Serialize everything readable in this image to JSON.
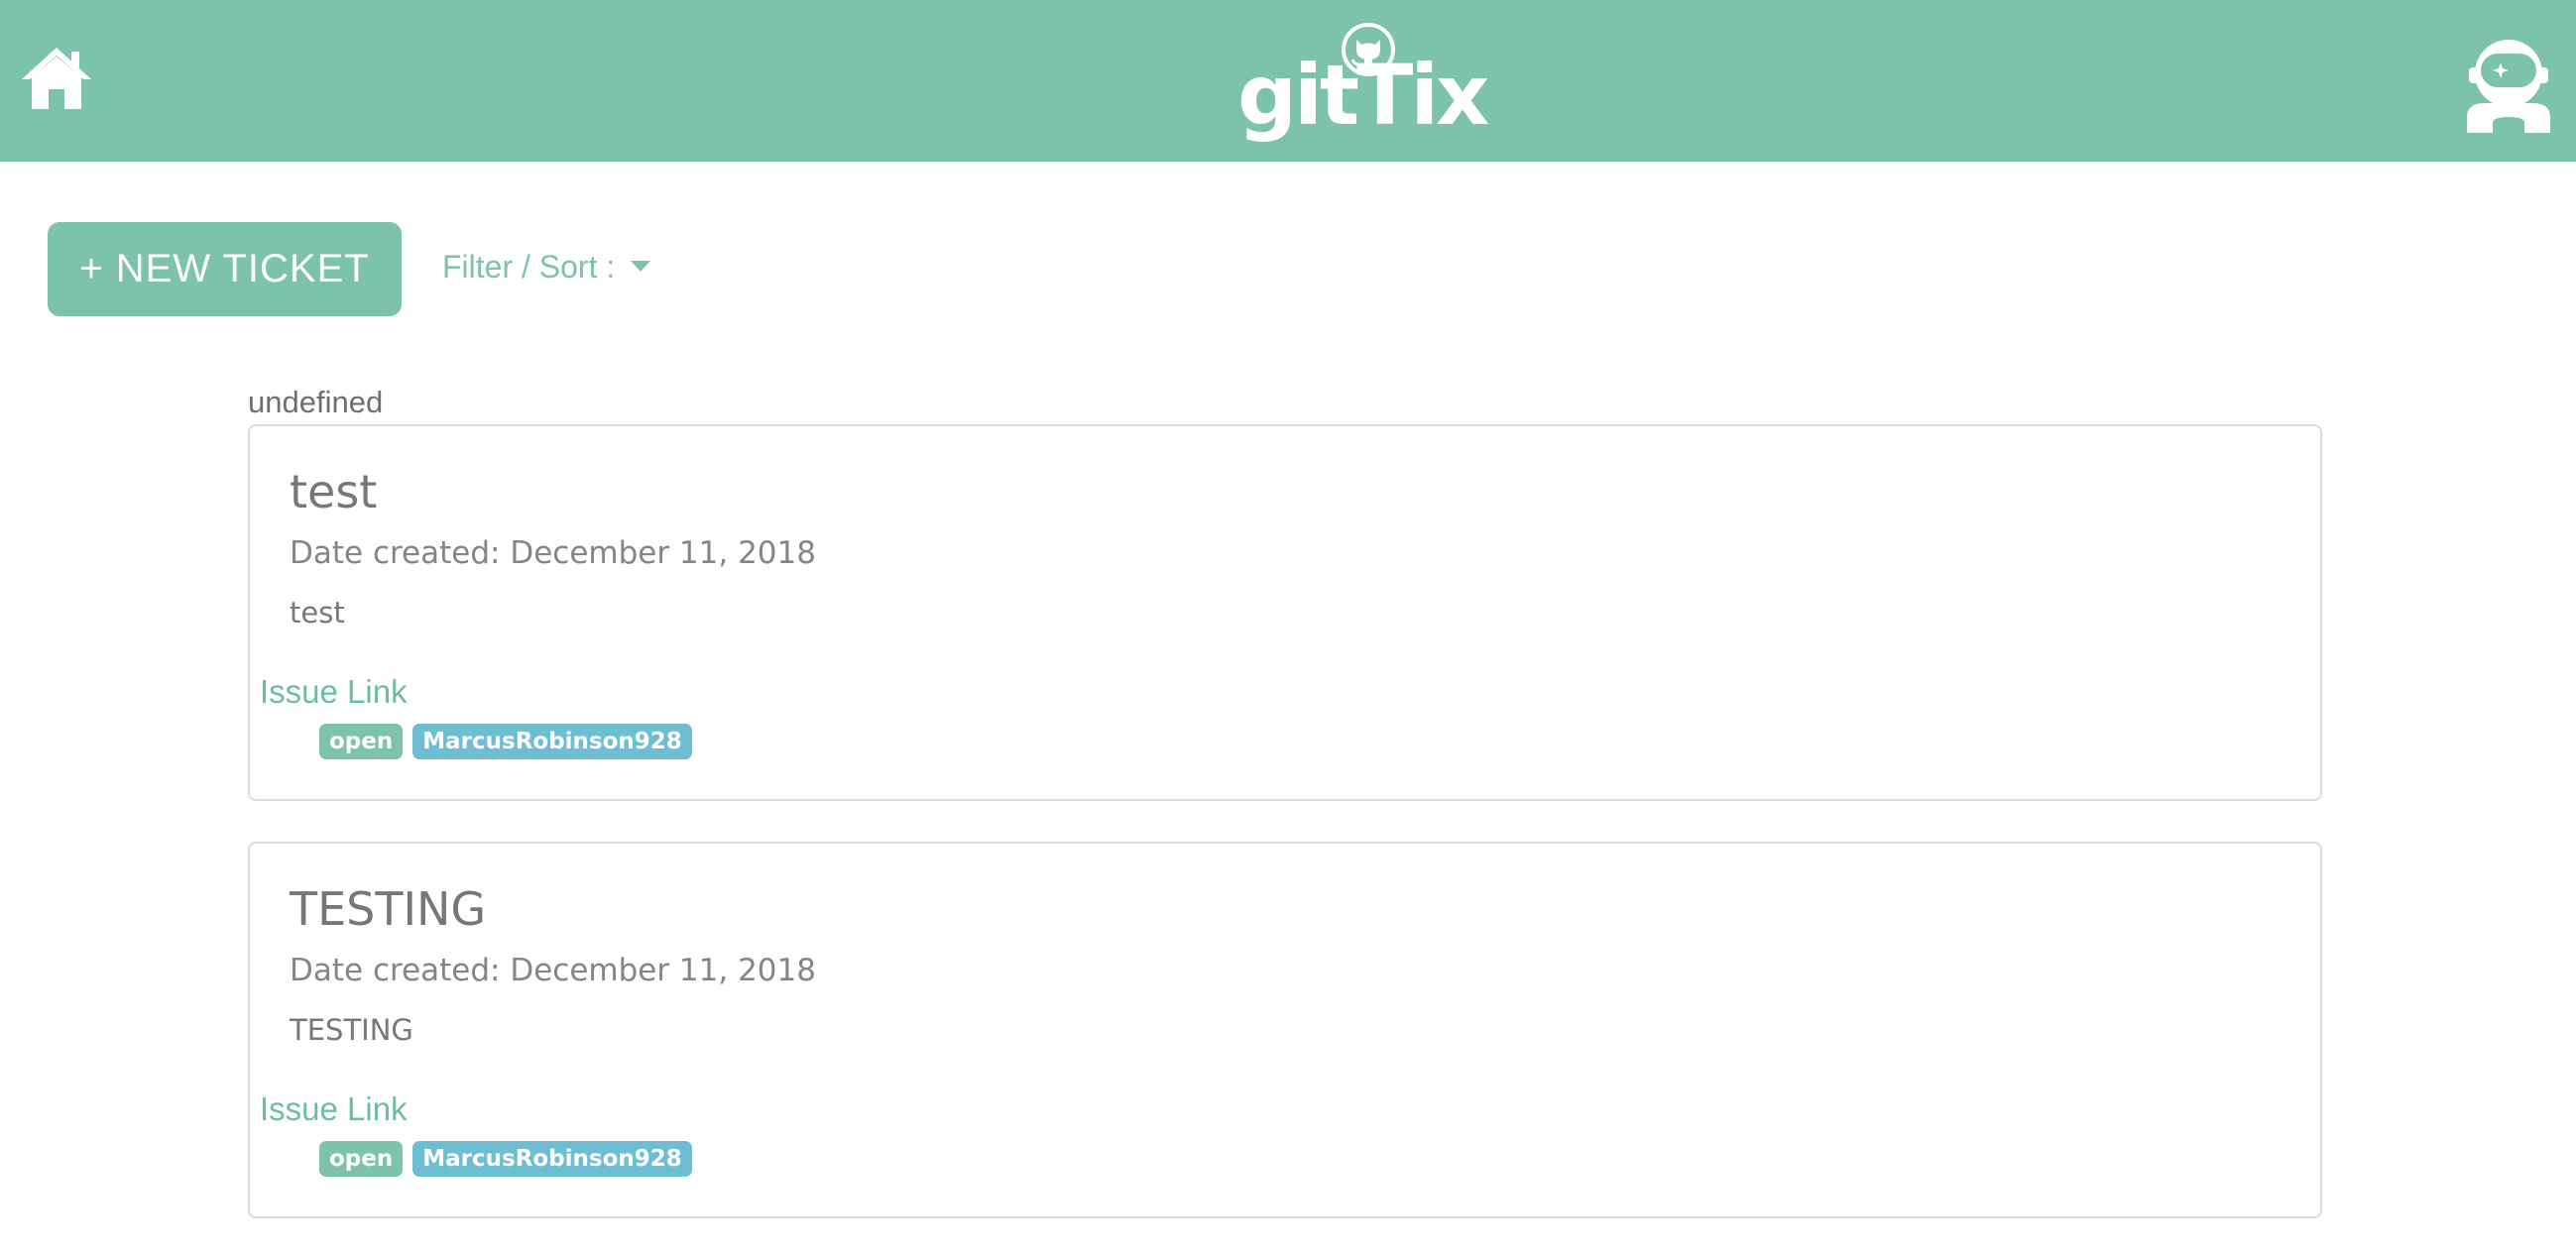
{
  "header": {
    "logo_text": "gitTix",
    "home_icon": "home-icon",
    "octocat_icon": "octocat-icon",
    "avatar_icon": "astronaut-avatar-icon"
  },
  "toolbar": {
    "new_ticket_label": "+ NEW TICKET",
    "filter_sort_label": "Filter / Sort :"
  },
  "section_label": "undefined",
  "tickets": [
    {
      "title": "test",
      "date": "Date created: December 11, 2018",
      "body": "test",
      "issue_link": "Issue Link",
      "status": "open",
      "assignee": "MarcusRobinson928"
    },
    {
      "title": "TESTING",
      "date": "Date created: December 11, 2018",
      "body": "TESTING",
      "issue_link": "Issue Link",
      "status": "open",
      "assignee": "MarcusRobinson928"
    }
  ],
  "colors": {
    "brand": "#7dc2ad",
    "status_badge": "#7dc2ad",
    "assignee_badge": "#6dbdd3"
  }
}
